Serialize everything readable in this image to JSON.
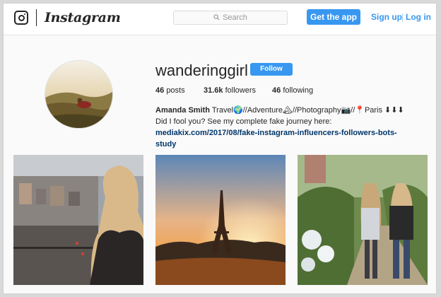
{
  "header": {
    "brand": "Instagram",
    "search_placeholder": "Search",
    "get_app_label": "Get the app",
    "signup_label": "Sign up",
    "separator": "|",
    "login_label": "Log in"
  },
  "profile": {
    "username": "wanderinggirl",
    "follow_label": "Follow",
    "posts": "46",
    "posts_label": "posts",
    "followers": "31.6k",
    "followers_label": "followers",
    "following": "46",
    "following_label": "following",
    "full_name": "Amanda Smith",
    "bio_text": "Travel🌍//Adventure🏔//Photography📷//📍Paris ⬇⬇⬇ Did I fool you? See my complete fake journey here:",
    "bio_link": "mediakix.com/2017/08/fake-instagram-influencers-followers-bots-study"
  },
  "posts": [
    {
      "subject": "woman with long blonde hair overlooking city"
    },
    {
      "subject": "eiffel tower at sunset"
    },
    {
      "subject": "two women walking on garden path"
    }
  ],
  "colors": {
    "accent": "#3897f0",
    "text": "#262626",
    "link": "#003569",
    "background": "#fafafa"
  }
}
